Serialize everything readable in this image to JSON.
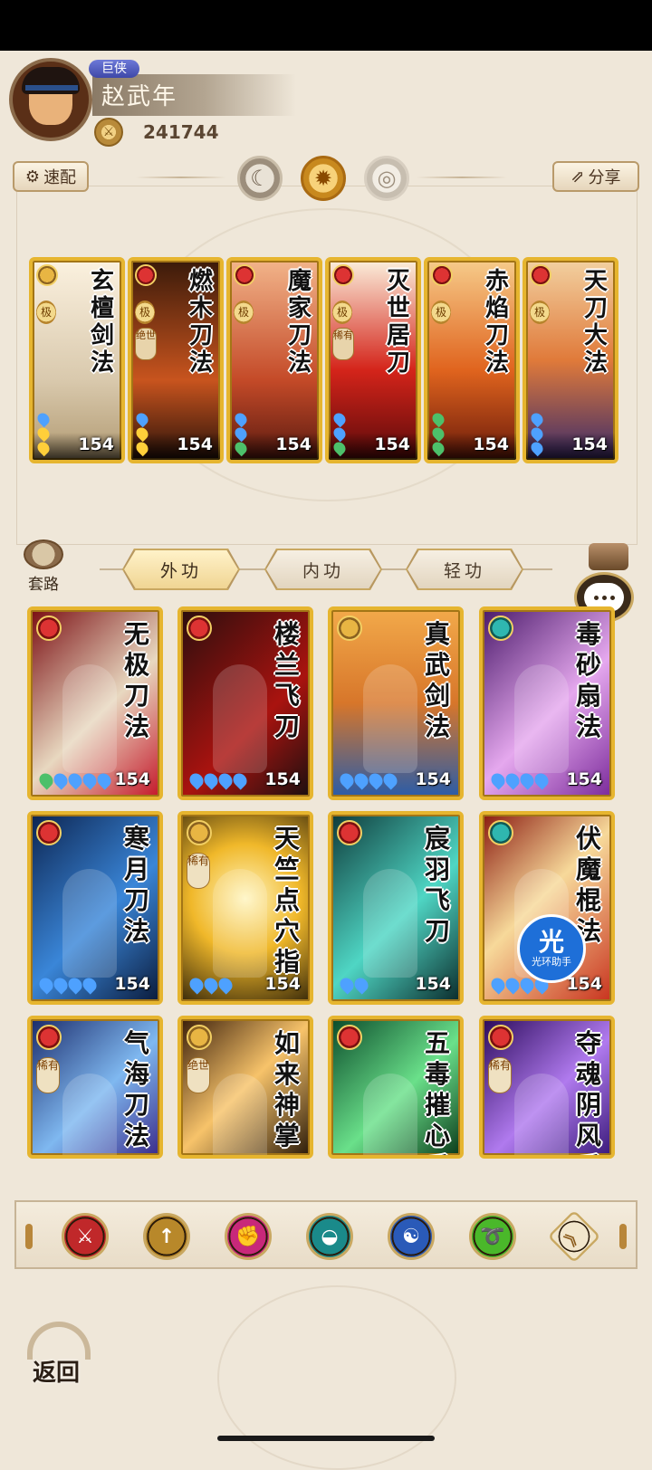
{
  "player": {
    "rank": "巨侠",
    "name": "赵武年",
    "power": "241744"
  },
  "toolbar": {
    "quick_label": "速配",
    "share_label": "分享"
  },
  "modes": {
    "moon": "moon-icon",
    "sun": "sun-icon",
    "ring": "ring-icon"
  },
  "equipped": [
    {
      "title": "玄檀剑法",
      "level": "154",
      "grade": "极",
      "extra": "",
      "type": "gold",
      "pips": [
        "blue",
        "gold",
        "gold"
      ]
    },
    {
      "title": "燃木刀法",
      "level": "154",
      "grade": "极",
      "extra": "绝世",
      "type": "red",
      "pips": [
        "blue",
        "gold",
        "gold"
      ]
    },
    {
      "title": "魔家刀法",
      "level": "154",
      "grade": "极",
      "extra": "",
      "type": "red",
      "pips": [
        "blue",
        "blue",
        "green"
      ]
    },
    {
      "title": "灭世居刀",
      "level": "154",
      "grade": "极",
      "extra": "稀有",
      "type": "red",
      "pips": [
        "blue",
        "blue",
        "green"
      ]
    },
    {
      "title": "赤焰刀法",
      "level": "154",
      "grade": "极",
      "extra": "",
      "type": "red",
      "pips": [
        "green",
        "green",
        "green"
      ]
    },
    {
      "title": "天刀大法",
      "level": "154",
      "grade": "极",
      "extra": "",
      "type": "red",
      "pips": [
        "blue",
        "blue",
        "blue"
      ]
    }
  ],
  "tabs": {
    "routine": "套路",
    "outer": "外功",
    "inner": "内功",
    "light": "轻功"
  },
  "skills": [
    {
      "title": "无极刀法",
      "level": "154",
      "type": "red",
      "tag": "",
      "pips": 5,
      "bg": "linear-gradient(135deg,#7a0d12,#e8d8c0 55%,#c4172a)"
    },
    {
      "title": "楼兰飞刀",
      "level": "154",
      "type": "red",
      "tag": "",
      "pips": 4,
      "bg": "linear-gradient(135deg,#2b0e0e,#a9130f 60%,#1a1010)"
    },
    {
      "title": "真武剑法",
      "level": "154",
      "type": "gold",
      "tag": "",
      "pips": 4,
      "bg": "linear-gradient(180deg,#f2a94a,#d7762a 50%,#2a5ca8)"
    },
    {
      "title": "毒砂扇法",
      "level": "154",
      "type": "teal",
      "tag": "",
      "pips": 4,
      "bg": "linear-gradient(135deg,#4a1a6a,#e5a8ee 55%,#7a2a9a)"
    },
    {
      "title": "寒月刀法",
      "level": "154",
      "type": "red",
      "tag": "",
      "pips": 4,
      "bg": "linear-gradient(135deg,#0c2450,#3a86d8 55%,#0a1a3a)"
    },
    {
      "title": "天竺点穴指",
      "level": "154",
      "type": "gold",
      "tag": "稀有",
      "pips": 3,
      "bg": "radial-gradient(circle at 50% 45%,#fff5c0,#f0b82a 45%,#3a2a0a)"
    },
    {
      "title": "宸羽飞刀",
      "level": "154",
      "type": "red",
      "tag": "",
      "pips": 2,
      "bg": "linear-gradient(135deg,#0e3a3a,#4fd6c4 55%,#0a2a2a)"
    },
    {
      "title": "伏魔棍法",
      "level": "154",
      "type": "teal",
      "tag": "",
      "pips": 4,
      "bg": "linear-gradient(135deg,#8a1a10,#f7d99a 45%,#c8321e)"
    },
    {
      "title": "气海刀法",
      "level": "",
      "type": "red",
      "tag": "稀有",
      "pips": 0,
      "bg": "linear-gradient(135deg,#1a2a6a,#7fb8f0 55%,#3a2a8a)"
    },
    {
      "title": "如来神掌",
      "level": "",
      "type": "gold",
      "tag": "绝世",
      "pips": 0,
      "bg": "linear-gradient(135deg,#3a1e0a,#f7c36a 50%,#2a1a0a)"
    },
    {
      "title": "五毒摧心爪",
      "level": "",
      "type": "red",
      "tag": "",
      "pips": 0,
      "bg": "linear-gradient(135deg,#0a4a2a,#6ae08a 55%,#0a3a1a)"
    },
    {
      "title": "夺魂阴风爪",
      "level": "",
      "type": "red",
      "tag": "稀有",
      "pips": 0,
      "bg": "linear-gradient(135deg,#2a0a5a,#b07aee 55%,#3a1a7a)"
    }
  ],
  "helper_badge": {
    "big": "光",
    "small": "光环助手"
  },
  "filters": [
    {
      "name": "sword-filter-icon",
      "color": "#c0282a",
      "glyph": "⚔"
    },
    {
      "name": "spear-filter-icon",
      "color": "#b8882a",
      "glyph": "↑"
    },
    {
      "name": "fist-filter-icon",
      "color": "#c8287a",
      "glyph": "✊"
    },
    {
      "name": "fan-filter-icon",
      "color": "#1a8a8a",
      "glyph": "◒"
    },
    {
      "name": "taiji-filter-icon",
      "color": "#2a5ab8",
      "glyph": "☯"
    },
    {
      "name": "whip-filter-icon",
      "color": "#4ab82a",
      "glyph": "➰"
    },
    {
      "name": "collapse-icon",
      "color": "#f2e6cc",
      "glyph": "︽"
    }
  ],
  "back_label": "返回"
}
